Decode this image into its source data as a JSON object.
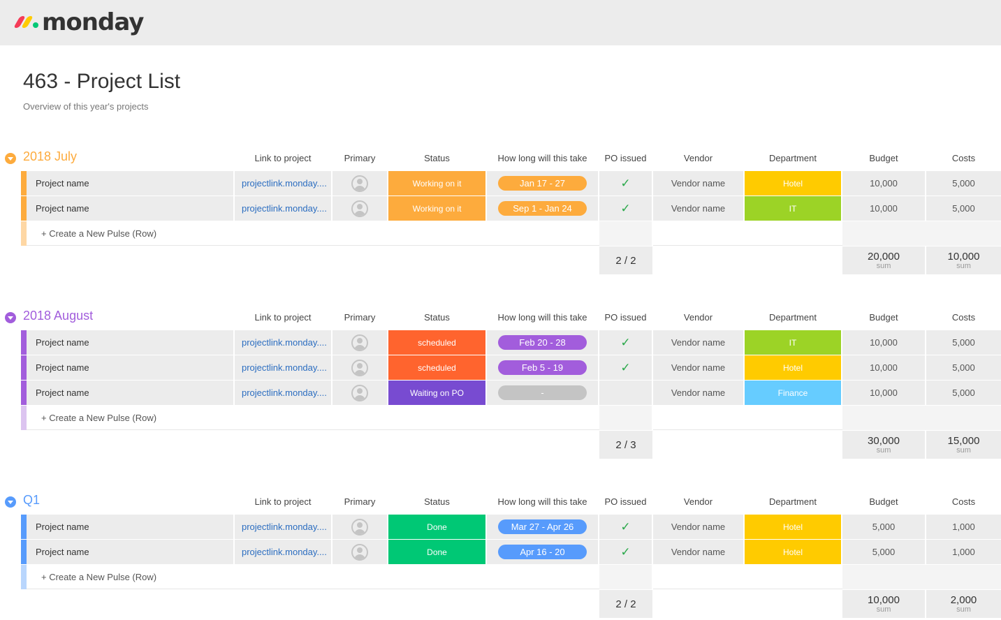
{
  "app": {
    "logo_text": "monday"
  },
  "board": {
    "title": "463 - Project List",
    "subtitle": "Overview of this year's projects"
  },
  "columns": {
    "link": "Link to project",
    "primary": "Primary",
    "status": "Status",
    "timeline": "How long will this take",
    "po": "PO issued",
    "vendor": "Vendor",
    "department": "Department",
    "budget": "Budget",
    "costs": "Costs"
  },
  "add_row_label": "+ Create a New Pulse (Row)",
  "sum_label": "sum",
  "colors": {
    "working": "#fdab3d",
    "scheduled": "#ff642e",
    "waiting": "#784bd1",
    "done": "#00c875",
    "hotel": "#ffcb00",
    "it": "#9cd326",
    "finance": "#66ccff",
    "tl_orange": "#fdab3d",
    "tl_purple": "#a25ddc",
    "tl_grey": "#c4c4c4",
    "tl_blue": "#579bfc",
    "group_july": "#fdab3d",
    "group_august": "#a25ddc",
    "group_q1": "#579bfc"
  },
  "groups": [
    {
      "name": "2018 July",
      "rows": [
        {
          "name": "Project name",
          "link": "projectlink.monday....",
          "status": "Working on it",
          "timeline": "Jan 17 - 27",
          "po_issued": true,
          "vendor": "Vendor name",
          "department": "Hotel",
          "budget": "10,000",
          "costs": "5,000"
        },
        {
          "name": "Project name",
          "link": "projectlink.monday....",
          "status": "Working on it",
          "timeline": "Sep 1 - Jan 24",
          "po_issued": true,
          "vendor": "Vendor name",
          "department": "IT",
          "budget": "10,000",
          "costs": "5,000"
        }
      ],
      "po_summary": "2 / 2",
      "budget_sum": "20,000",
      "costs_sum": "10,000"
    },
    {
      "name": "2018 August",
      "rows": [
        {
          "name": "Project name",
          "link": "projectlink.monday....",
          "status": "scheduled",
          "timeline": "Feb 20 - 28",
          "po_issued": true,
          "vendor": "Vendor name",
          "department": "IT",
          "budget": "10,000",
          "costs": "5,000"
        },
        {
          "name": "Project name",
          "link": "projectlink.monday....",
          "status": "scheduled",
          "timeline": "Feb 5 - 19",
          "po_issued": true,
          "vendor": "Vendor name",
          "department": "Hotel",
          "budget": "10,000",
          "costs": "5,000"
        },
        {
          "name": "Project name",
          "link": "projectlink.monday....",
          "status": "Waiting on PO",
          "timeline": "-",
          "po_issued": false,
          "vendor": "Vendor name",
          "department": "Finance",
          "budget": "10,000",
          "costs": "5,000"
        }
      ],
      "po_summary": "2 / 3",
      "budget_sum": "30,000",
      "costs_sum": "15,000"
    },
    {
      "name": "Q1",
      "rows": [
        {
          "name": "Project name",
          "link": "projectlink.monday....",
          "status": "Done",
          "timeline": "Mar 27 - Apr 26",
          "po_issued": true,
          "vendor": "Vendor name",
          "department": "Hotel",
          "budget": "5,000",
          "costs": "1,000"
        },
        {
          "name": "Project name",
          "link": "projectlink.monday....",
          "status": "Done",
          "timeline": "Apr 16 - 20",
          "po_issued": true,
          "vendor": "Vendor name",
          "department": "Hotel",
          "budget": "5,000",
          "costs": "1,000"
        }
      ],
      "po_summary": "2 / 2",
      "budget_sum": "10,000",
      "costs_sum": "2,000"
    }
  ]
}
